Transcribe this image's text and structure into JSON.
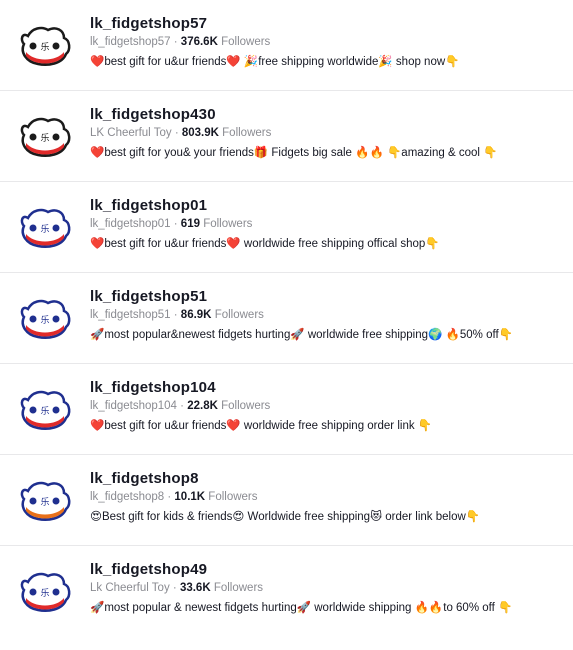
{
  "colors": {
    "divider": "#e8e8ea",
    "meta_text": "#8a8b91",
    "primary_text": "#161823",
    "avatar_red": "#e02a2a",
    "avatar_blue": "#1f2f8f"
  },
  "accounts": [
    {
      "username": "lk_fidgetshop57",
      "nickname": "lk_fidgetshop57",
      "followers": "376.6K",
      "followers_label": "Followers",
      "bio": "❤️best gift for u&ur friends❤️ 🎉free shipping worldwide🎉 shop now👇"
    },
    {
      "username": "lk_fidgetshop430",
      "nickname": "LK Cheerful Toy",
      "followers": "803.9K",
      "followers_label": "Followers",
      "bio": "❤️best gift for you& your friends🎁 Fidgets big sale 🔥🔥 👇amazing & cool 👇"
    },
    {
      "username": "lk_fidgetshop01",
      "nickname": "lk_fidgetshop01",
      "followers": "619",
      "followers_label": "Followers",
      "bio": "❤️best gift for u&ur friends❤️ worldwide free shipping offical shop👇"
    },
    {
      "username": "lk_fidgetshop51",
      "nickname": "lk_fidgetshop51",
      "followers": "86.9K",
      "followers_label": "Followers",
      "bio": "🚀most popular&newest fidgets hurting🚀 worldwide free shipping🌍 🔥50% off👇"
    },
    {
      "username": "lk_fidgetshop104",
      "nickname": "lk_fidgetshop104",
      "followers": "22.8K",
      "followers_label": "Followers",
      "bio": "❤️best gift for u&ur friends❤️ worldwide free shipping order link 👇"
    },
    {
      "username": "lk_fidgetshop8",
      "nickname": "lk_fidgetshop8",
      "followers": "10.1K",
      "followers_label": "Followers",
      "bio": "😍Best gift for kids & friends😍 Worldwide free shipping😻 order link below👇"
    },
    {
      "username": "lk_fidgetshop49",
      "nickname": "Lk Cheerful Toy",
      "followers": "33.6K",
      "followers_label": "Followers",
      "bio": "🚀most popular & newest fidgets hurting🚀 worldwide shipping 🔥🔥to 60% off 👇"
    }
  ]
}
